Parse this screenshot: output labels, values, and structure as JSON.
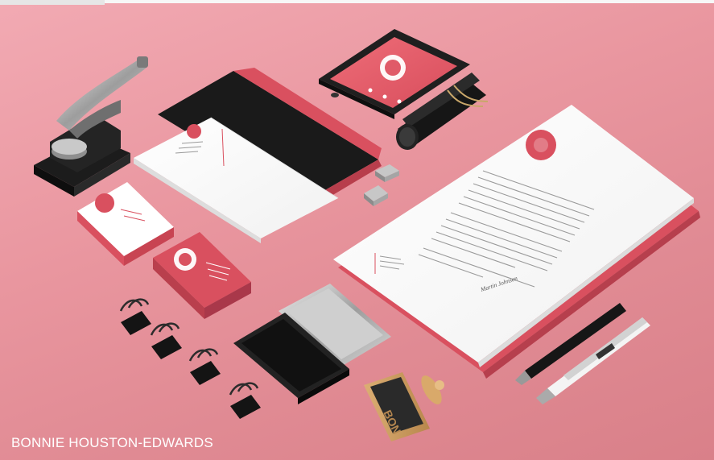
{
  "photo": {
    "credit": "BONNIE HOUSTON-EDWARDS",
    "brand_mark": "BON",
    "signature": "Martin Johnson",
    "colors": {
      "background": "#e9969f",
      "brand": "#d9505f",
      "paper": "#ffffff",
      "black": "#1b1b1b",
      "metal": "#b9b9b9",
      "wood": "#c99a5e"
    }
  }
}
